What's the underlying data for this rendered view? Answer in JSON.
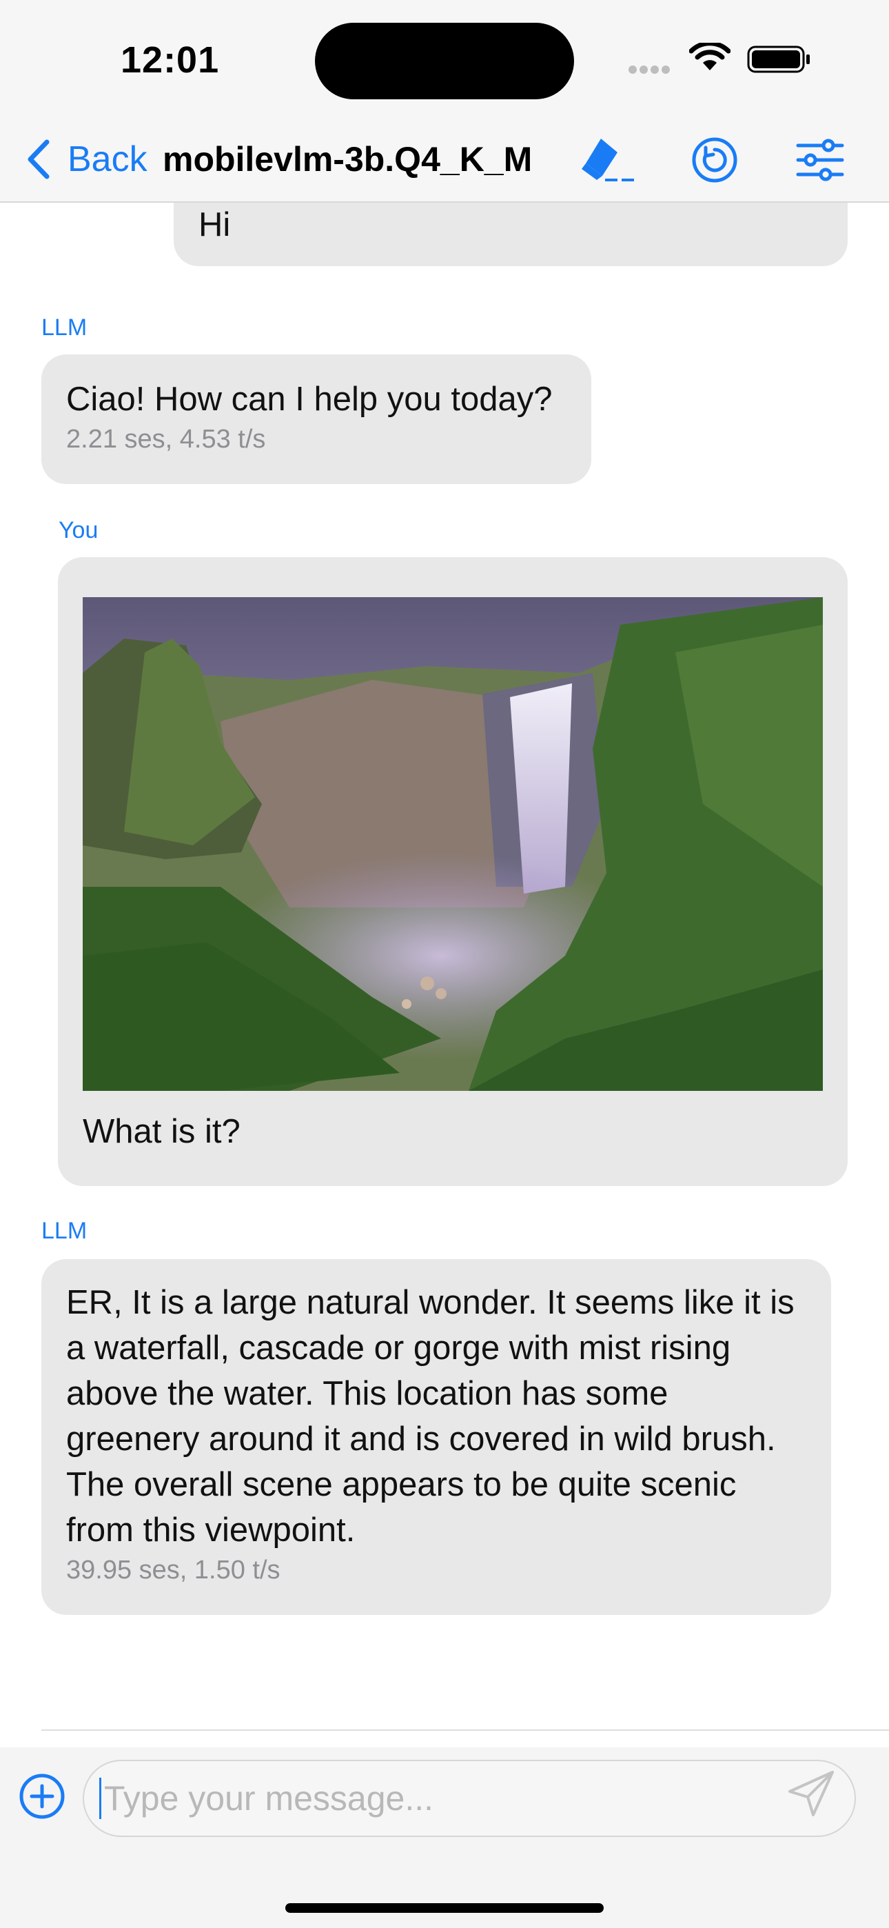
{
  "status_bar": {
    "time": "12:01"
  },
  "nav": {
    "back_label": "Back",
    "title": "mobilevlm-3b.Q4_K_M",
    "icons": [
      "eraser-icon",
      "reload-icon",
      "settings-sliders-icon"
    ]
  },
  "messages": [
    {
      "sender": "",
      "text": "Hi"
    },
    {
      "sender": "LLM",
      "text": "Ciao! How can I help you today?",
      "meta": "2.21 ses, 4.53 t/s"
    },
    {
      "sender": "You",
      "text": "What is it?",
      "has_image": true
    },
    {
      "sender": "LLM",
      "text": "ER, It is a large natural wonder. It seems like it is a waterfall, cascade or gorge with mist rising above the water. This location has some greenery around it and is covered in wild brush. The overall scene appears to be quite scenic from this viewpoint.",
      "meta": "39.95 ses, 1.50 t/s"
    }
  ],
  "composer": {
    "placeholder": "Type your message..."
  },
  "colors": {
    "accent": "#1a7cf5",
    "bubble": "#e8e8e8",
    "meta_text": "#8e8e93"
  }
}
